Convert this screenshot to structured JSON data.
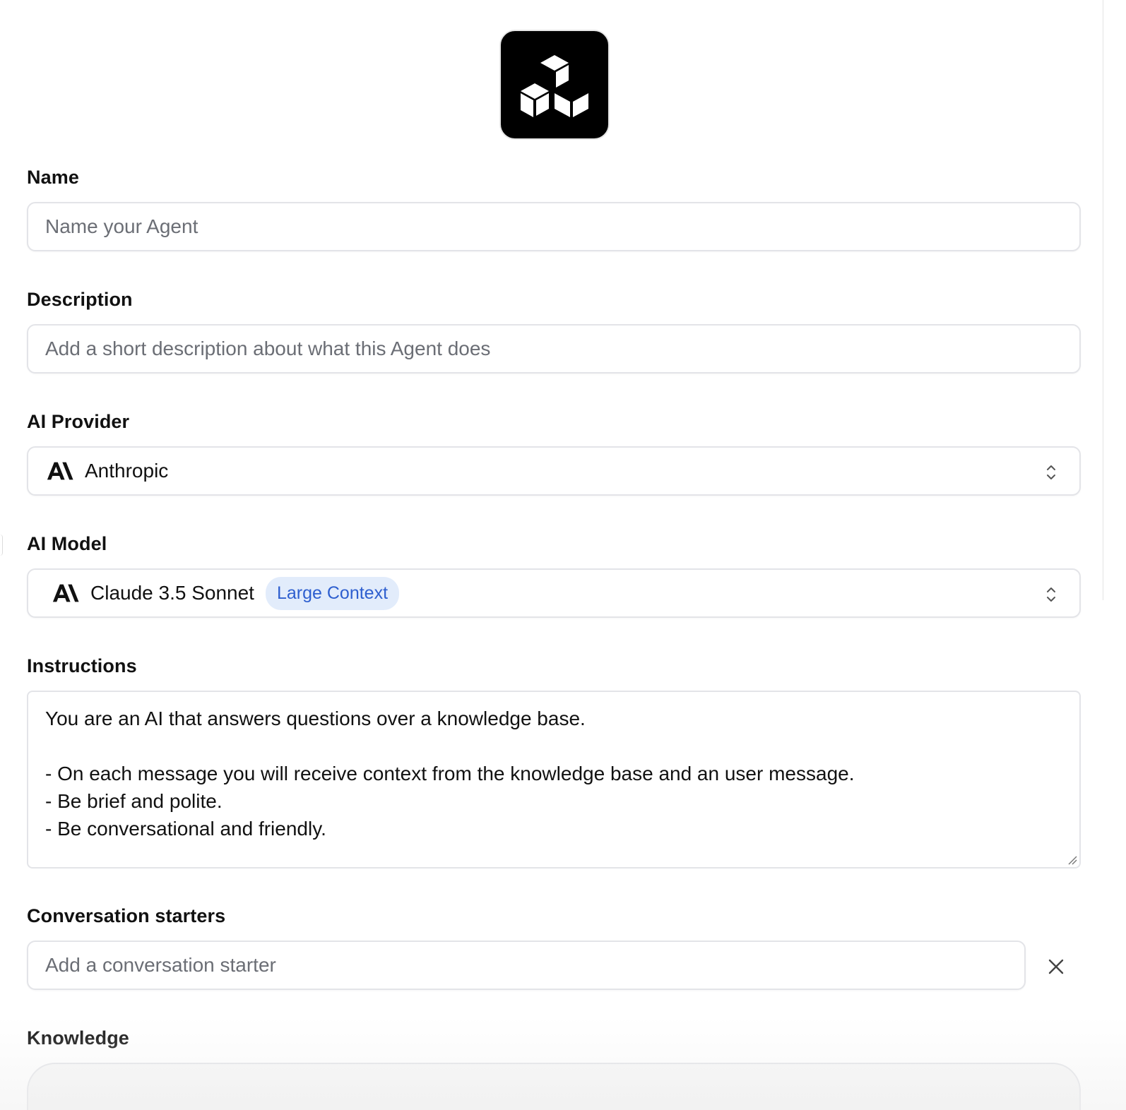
{
  "logo": {
    "icon": "cubes-logo-icon"
  },
  "fields": {
    "name": {
      "label": "Name",
      "placeholder": "Name your Agent",
      "value": ""
    },
    "description": {
      "label": "Description",
      "placeholder": "Add a short description about what this Agent does",
      "value": ""
    },
    "ai_provider": {
      "label": "AI Provider",
      "value": "Anthropic",
      "icon": "anthropic-icon"
    },
    "ai_model": {
      "label": "AI Model",
      "value": "Claude 3.5 Sonnet",
      "badge": "Large Context",
      "icon": "anthropic-icon"
    },
    "instructions": {
      "label": "Instructions",
      "value": "You are an AI that answers questions over a knowledge base.\n\n- On each message you will receive context from the knowledge base and an user message.\n- Be brief and polite.\n- Be conversational and friendly."
    },
    "conversation_starters": {
      "label": "Conversation starters",
      "placeholder": "Add a conversation starter",
      "value": ""
    },
    "knowledge": {
      "label": "Knowledge"
    }
  },
  "colors": {
    "badge_bg": "#e2ecfb",
    "badge_text": "#2e5fcf",
    "border": "#e3e4e8",
    "placeholder": "#6b6e75"
  }
}
